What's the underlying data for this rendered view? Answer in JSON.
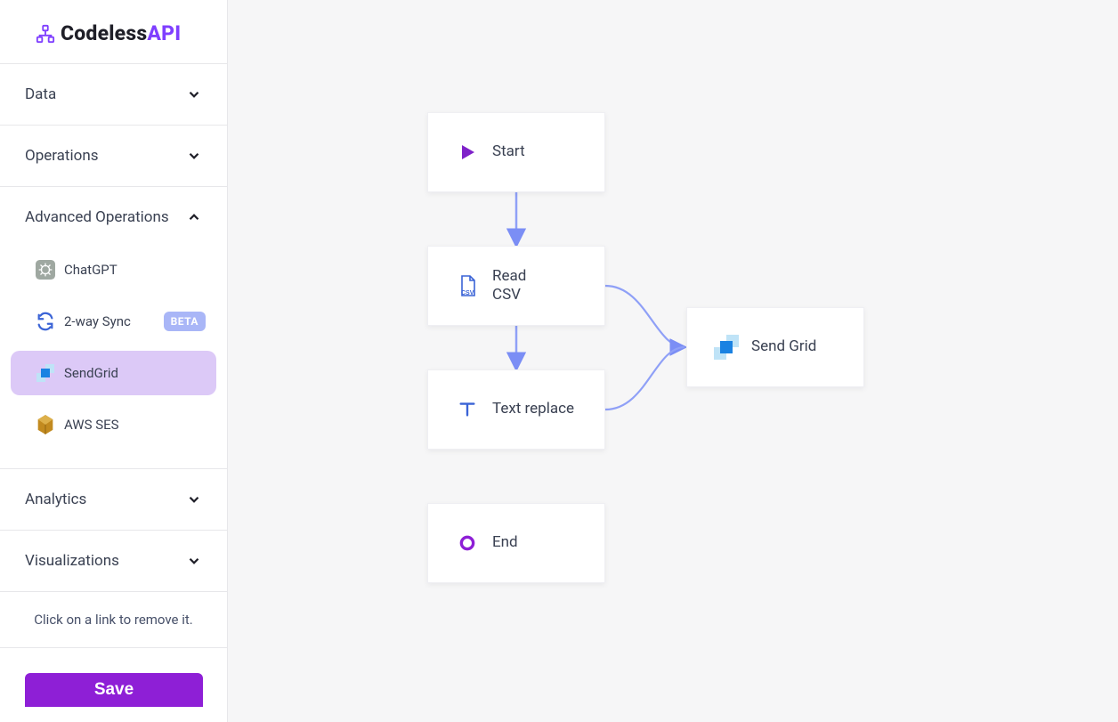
{
  "brand": {
    "name_a": "Codeless",
    "name_b": "API"
  },
  "sidebar": {
    "sections": [
      {
        "label": "Data",
        "expanded": false
      },
      {
        "label": "Operations",
        "expanded": false
      },
      {
        "label": "Advanced Operations",
        "expanded": true
      },
      {
        "label": "Analytics",
        "expanded": false
      },
      {
        "label": "Visualizations",
        "expanded": false
      }
    ],
    "advanced_items": [
      {
        "label": "ChatGPT",
        "icon": "chatgpt-icon",
        "badge": null,
        "selected": false
      },
      {
        "label": "2-way Sync",
        "icon": "sync-icon",
        "badge": "BETA",
        "selected": false
      },
      {
        "label": "SendGrid",
        "icon": "sendgrid-icon",
        "badge": null,
        "selected": true
      },
      {
        "label": "AWS SES",
        "icon": "aws-ses-icon",
        "badge": null,
        "selected": false
      }
    ]
  },
  "hint_text": "Click on a link to remove it.",
  "save_label": "Save",
  "nodes": {
    "start": {
      "label": "Start"
    },
    "read_csv": {
      "label": "Read CSV"
    },
    "text_replace": {
      "label": "Text replace"
    },
    "send_grid": {
      "label": "Send Grid"
    },
    "end": {
      "label": "End"
    }
  },
  "colors": {
    "accent_purple": "#8e1fd6",
    "brand_purple": "#7f3fff",
    "selected_bg": "#dcc9f7",
    "badge_bg": "#a9b6f7",
    "wire": "#8fa0f7",
    "arrow": "#7b8ef5"
  }
}
